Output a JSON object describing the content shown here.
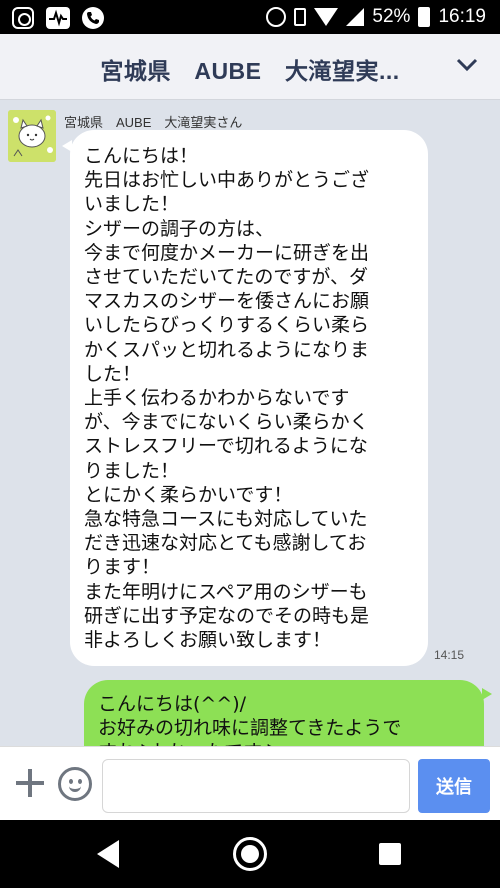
{
  "status_bar": {
    "battery": "52%",
    "time": "16:19",
    "icons": [
      "instagram-icon",
      "activity-icon",
      "phone-icon",
      "alarm-icon",
      "vibrate-icon",
      "wifi-icon",
      "signal-icon",
      "battery-icon"
    ]
  },
  "header": {
    "title": "宮城県　AUBE　大滝望実...",
    "menu_icon": "chevron-down-icon"
  },
  "messages": [
    {
      "direction": "incoming",
      "sender": "宮城県　AUBE　大滝望実さん",
      "text": "こんにちは！\n先日はお忙しい中ありがとうござ\nいました！\nシザーの調子の方は、\n今まで何度かメーカーに研ぎを出\nさせていただいてたのですが、ダ\nマスカスのシザーを倭さんにお願\nいしたらびっくりするくらい柔ら\nかくスパッと切れるようになりま\nした！\n上手く伝わるかわからないです\nが、今までにないくらい柔らかく\nストレスフリーで切れるようにな\nりました！\nとにかく柔らかいです！\n急な特急コースにも対応していた\nだき迅速な対応とても感謝してお\nります！\nまた年明けにスペア用のシザーも\n研ぎに出す予定なのでその時も是\n非よろしくお願い致します！",
      "time": "14:15"
    },
    {
      "direction": "outgoing",
      "text": "こんにちは(^^)/\nお好みの切れ味に調整てきたようで\nすね♪よかったです♪"
    }
  ],
  "input_bar": {
    "placeholder": "",
    "send_label": "送信"
  },
  "colors": {
    "incoming_bubble": "#ffffff",
    "outgoing_bubble": "#8de055",
    "chat_background": "#dde2ea",
    "send_button": "#5b8ff0",
    "header_title": "#2f3b57"
  }
}
